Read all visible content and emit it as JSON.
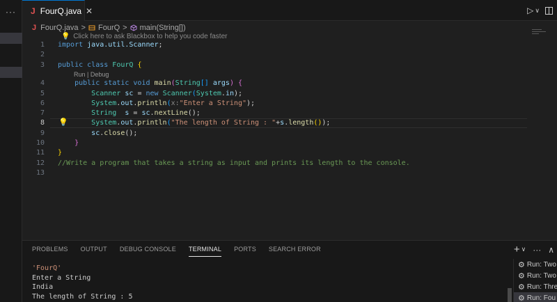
{
  "sidebar": {
    "menu": "···"
  },
  "tab": {
    "icon": "J",
    "label": "FourQ.java",
    "close": "✕"
  },
  "actions": {
    "run": "▷",
    "run_dropdown": "∨"
  },
  "breadcrumb": {
    "icon": "J",
    "file": "FourQ.java",
    "sep1": ">",
    "class": "FourQ",
    "sep2": ">",
    "method": "main(String[])"
  },
  "hint": "Click here to ask Blackbox to help you code faster",
  "codelens": "Run | Debug",
  "line_numbers": [
    "1",
    "2",
    "3",
    "4",
    "5",
    "6",
    "7",
    "8",
    "9",
    "10",
    "11",
    "12",
    "13"
  ],
  "code": {
    "l1": [
      "import",
      "java.util.Scanner",
      ";"
    ],
    "l3": [
      "public",
      "class",
      "FourQ",
      "{"
    ],
    "l4": [
      "public",
      "static",
      "void",
      "main",
      "(",
      "String",
      "[]",
      "args",
      ")",
      "{"
    ],
    "l5": [
      "Scanner",
      "sc",
      "=",
      "new",
      "Scanner",
      "(",
      "System",
      ".",
      "in",
      ");"
    ],
    "l6": [
      "System",
      ".",
      "out",
      ".",
      "println",
      "(",
      "x:",
      "\"Enter a String\"",
      ");"
    ],
    "l7": [
      "String",
      "s",
      "=",
      "sc",
      ".",
      "nextLine",
      "();"
    ],
    "l8": [
      "System",
      ".",
      "out",
      ".",
      "println",
      "(",
      "\"The length of String : \"",
      "+",
      "s",
      ".",
      "length",
      "()",
      ");"
    ],
    "l9": [
      "sc",
      ".",
      "close",
      "();"
    ],
    "l10": "}",
    "l11": "}",
    "l12": "//Write a program that takes a string as input and prints its length to the console."
  },
  "panel": {
    "tabs": [
      "PROBLEMS",
      "OUTPUT",
      "DEBUG CONSOLE",
      "TERMINAL",
      "PORTS",
      "SEARCH ERROR"
    ],
    "active_tab": "TERMINAL",
    "actions": {
      "add": "+",
      "dropdown": "∨",
      "more": "···",
      "collapse": "∧"
    }
  },
  "terminal": {
    "lines": [
      "'FourQ'",
      "Enter a String",
      "India",
      "The length of String : 5"
    ]
  },
  "terminal_list": [
    "Run: Two",
    "Run: Two",
    "Run: Thre",
    "Run: Fou"
  ],
  "colors": {
    "accent": "#0078d4",
    "java_icon": "#e05252",
    "keyword": "#569cd6",
    "type": "#4ec9b0",
    "string": "#ce9178",
    "comment": "#6a9955"
  }
}
